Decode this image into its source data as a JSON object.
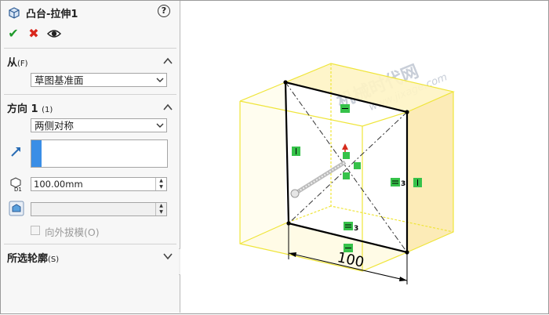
{
  "feature": {
    "title": "凸台-拉伸1",
    "help": "?"
  },
  "actions": {
    "ok": "✔",
    "cancel": "✖",
    "preview": "preview"
  },
  "from_group": {
    "title": "从",
    "hint": "(F)",
    "selected": "草图基准面"
  },
  "direction_group": {
    "title": "方向 1",
    "hint": "(1)",
    "end_condition": "两侧对称",
    "depth": "100.00mm",
    "draft_value": "",
    "draft_outward_label": "向外拔模(O)"
  },
  "contours_group": {
    "title": "所选轮廓",
    "hint": "(S)"
  },
  "viewport": {
    "watermark_cn": "机械时代网",
    "watermark_url": "www.jixage.com",
    "dimension": "100",
    "relation_tags": [
      "3",
      "3"
    ]
  },
  "colors": {
    "preview_fill": "#fdf1b8",
    "preview_edge": "#f0e63c",
    "relation_green": "#36c24a",
    "accent_blue": "#3a8ee6"
  }
}
